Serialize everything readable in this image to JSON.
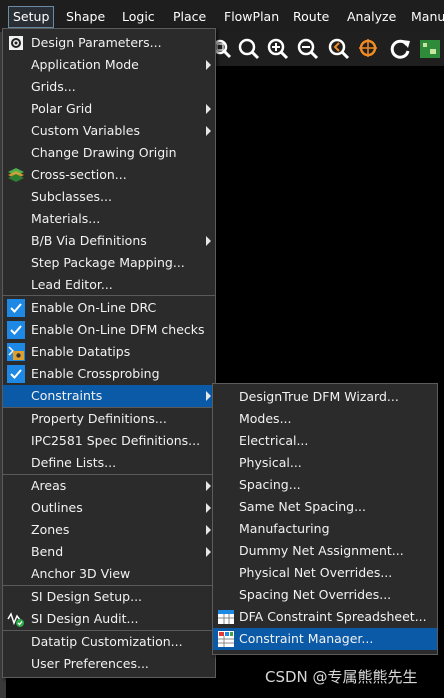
{
  "menubar": {
    "items": [
      "Setup",
      "Shape",
      "Logic",
      "Place",
      "FlowPlan",
      "Route",
      "Analyze",
      "Manu"
    ]
  },
  "toolbar": {
    "icons": [
      "zoom-fit-icon",
      "zoom-in-icon",
      "zoom-out-icon",
      "zoom-previous-icon",
      "zoom-center-icon",
      "refresh-icon",
      "board-icon"
    ]
  },
  "setup_menu": {
    "items": [
      {
        "label": "Design Parameters...",
        "icon": "design-parameters-icon"
      },
      {
        "label": "Application Mode",
        "submenu": true
      },
      {
        "label": "Grids..."
      },
      {
        "label": "Polar Grid",
        "submenu": true
      },
      {
        "label": "Custom Variables",
        "submenu": true
      },
      {
        "label": "Change Drawing Origin"
      },
      {
        "label": "Cross-section...",
        "icon": "cross-section-icon"
      },
      {
        "label": "Subclasses..."
      },
      {
        "label": "Materials..."
      },
      {
        "label": "B/B Via Definitions",
        "submenu": true
      },
      {
        "label": "Step Package Mapping..."
      },
      {
        "label": "Lead Editor..."
      },
      {
        "label": "Enable On-Line DRC",
        "checked": true
      },
      {
        "label": "Enable On-Line DFM checks",
        "checked": true
      },
      {
        "label": "Enable Datatips",
        "icon": "datatips-icon"
      },
      {
        "label": "Enable Crossprobing",
        "checked": true
      },
      {
        "label": "Constraints",
        "submenu": true,
        "highlighted": true
      },
      {
        "label": "Property Definitions..."
      },
      {
        "label": "IPC2581 Spec Definitions..."
      },
      {
        "label": "Define Lists..."
      },
      {
        "label": "Areas",
        "submenu": true
      },
      {
        "label": "Outlines",
        "submenu": true
      },
      {
        "label": "Zones",
        "submenu": true
      },
      {
        "label": "Bend",
        "submenu": true
      },
      {
        "label": "Anchor 3D View"
      },
      {
        "label": "SI Design Setup..."
      },
      {
        "label": "SI Design Audit...",
        "icon": "si-audit-icon"
      },
      {
        "label": "Datatip Customization..."
      },
      {
        "label": "User Preferences..."
      }
    ]
  },
  "constraints_submenu": {
    "items": [
      {
        "label": "DesignTrue DFM Wizard..."
      },
      {
        "label": "Modes..."
      },
      {
        "label": "Electrical..."
      },
      {
        "label": "Physical..."
      },
      {
        "label": "Spacing..."
      },
      {
        "label": "Same Net Spacing..."
      },
      {
        "label": "Manufacturing"
      },
      {
        "label": "Dummy Net Assignment..."
      },
      {
        "label": "Physical Net Overrides..."
      },
      {
        "label": "Spacing Net Overrides..."
      },
      {
        "label": "DFA Constraint Spreadsheet...",
        "icon": "dfa-spreadsheet-icon"
      },
      {
        "label": "Constraint Manager...",
        "icon": "constraint-manager-icon",
        "highlighted": true
      }
    ]
  },
  "watermark": "CSDN @专属熊熊先生",
  "colors": {
    "menu_bg": "#2b2b2b",
    "highlight": "#0a5aa8",
    "checkbox": "#1e88e5"
  }
}
